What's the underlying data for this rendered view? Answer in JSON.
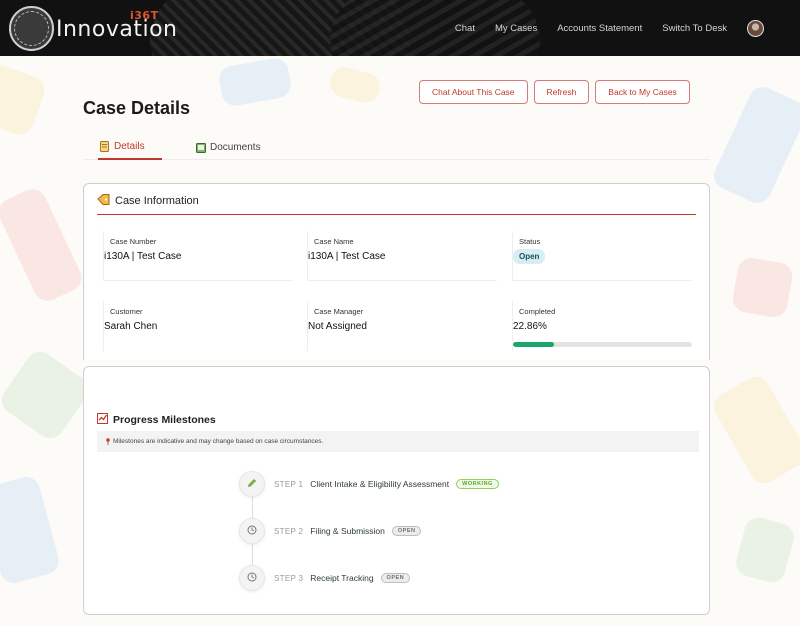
{
  "header": {
    "logo_text": "Innovation",
    "logo_superscript": "i36T",
    "nav": [
      "Chat",
      "My Cases",
      "Accounts Statement",
      "Switch To Desk"
    ]
  },
  "page": {
    "title": "Case Details",
    "actions": {
      "chat": "Chat About This Case",
      "refresh": "Refresh",
      "back": "Back to My Cases"
    },
    "tabs": [
      {
        "label": "Details",
        "active": true
      },
      {
        "label": "Documents",
        "active": false
      }
    ]
  },
  "case_info": {
    "title": "Case Information",
    "fields": {
      "case_number": {
        "label": "Case Number",
        "value": "i130A | Test Case"
      },
      "case_name": {
        "label": "Case Name",
        "value": "i130A | Test Case"
      },
      "status": {
        "label": "Status",
        "value": "Open"
      },
      "customer": {
        "label": "Customer",
        "value": "Sarah Chen"
      },
      "case_manager": {
        "label": "Case Manager",
        "value": "Not Assigned"
      },
      "completed": {
        "label": "Completed",
        "value": "22.86%",
        "fraction": 0.2286
      }
    }
  },
  "milestones": {
    "title": "Progress Milestones",
    "notice": "Milestones are indicative and may change based on case circumstances.",
    "steps": [
      {
        "number": "STEP 1",
        "name": "Client Intake & Eligibility Assessment",
        "status": "WORKING",
        "icon": "pencil-icon"
      },
      {
        "number": "STEP 2",
        "name": "Filing & Submission",
        "status": "OPEN",
        "icon": "clock-icon"
      },
      {
        "number": "STEP 3",
        "name": "Receipt Tracking",
        "status": "OPEN",
        "icon": "clock-icon"
      }
    ]
  },
  "colors": {
    "accent": "#c0392b",
    "progress": "#1aa56a",
    "header_bg": "#111111"
  }
}
